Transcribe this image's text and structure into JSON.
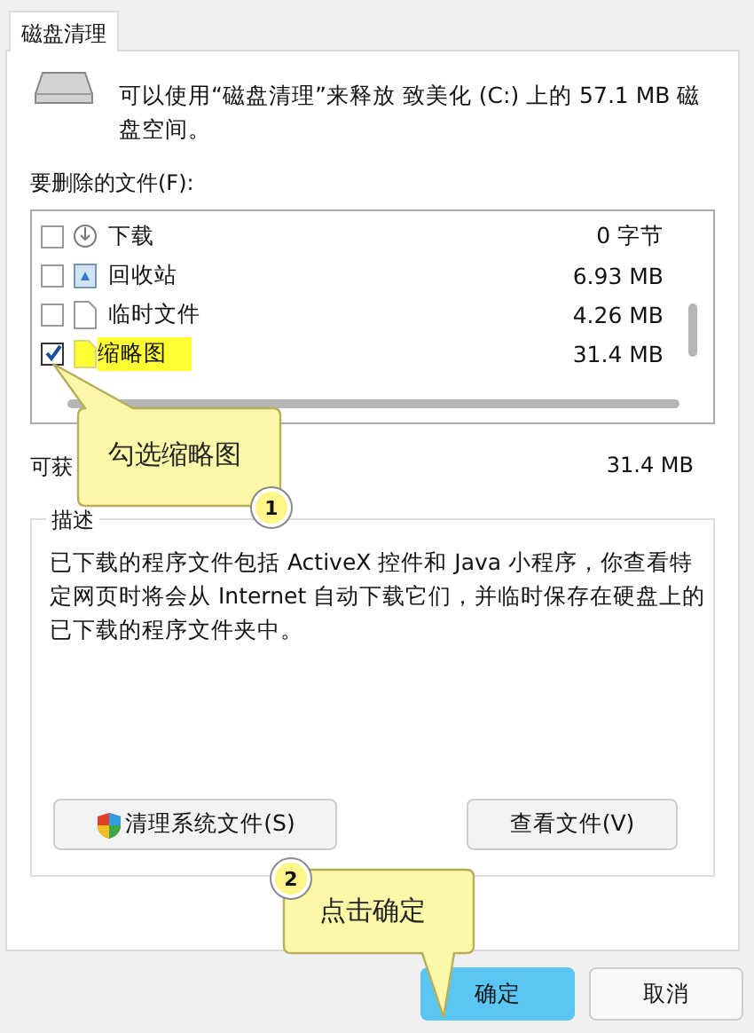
{
  "tabs": [
    {
      "label": "磁盘清理",
      "selected": true
    }
  ],
  "header_text": "可以使用“磁盘清理”来释放 致美化 (C:) 上的 57.1 MB 磁盘空间。",
  "files_label": "要删除的文件(F):",
  "files": [
    {
      "kind": "download",
      "name": "下载",
      "size": "0 字节",
      "checked": false,
      "highlighted": false
    },
    {
      "kind": "recycle",
      "name": "回收站",
      "size": "6.93 MB",
      "checked": false,
      "highlighted": false
    },
    {
      "kind": "file",
      "name": "临时文件",
      "size": "4.26 MB",
      "checked": false,
      "highlighted": false
    },
    {
      "kind": "thumbnail",
      "name": "缩略图",
      "size": "31.4 MB",
      "checked": true,
      "highlighted": true
    }
  ],
  "gain_label": "可获",
  "gain_value": "31.4 MB",
  "description": {
    "legend": "描述",
    "text": "已下载的程序文件包括 ActiveX 控件和 Java 小程序，你查看特定网页时将会从 Internet 自动下载它们，并临时保存在硬盘上的已下载的程序文件夹中。"
  },
  "panel_buttons": [
    {
      "kind": "shield",
      "label": "清理系统文件(S)"
    },
    {
      "kind": "plain",
      "label": "查看文件(V)"
    }
  ],
  "dialog_buttons": [
    {
      "label": "确定",
      "selected": true
    },
    {
      "label": "取消",
      "selected": false
    }
  ],
  "callouts": [
    {
      "step": "1",
      "text": "勾选缩略图"
    },
    {
      "step": "2",
      "text": "点击确定"
    }
  ]
}
